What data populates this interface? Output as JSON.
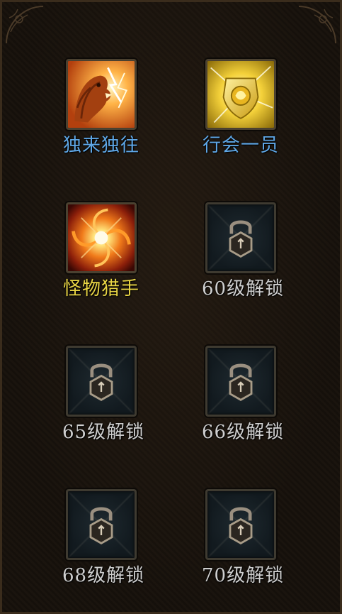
{
  "slots": [
    {
      "label": "独来独往",
      "icon": "lion-roar-icon",
      "state": "unlocked",
      "color": "#5fa7e6"
    },
    {
      "label": "行会一员",
      "icon": "golden-shield-icon",
      "state": "unlocked",
      "color": "#5fa7e6"
    },
    {
      "label": "怪物猎手",
      "icon": "fire-vortex-icon",
      "state": "active",
      "color": "#e9d545"
    },
    {
      "label": "60级解锁",
      "icon": "padlock-icon",
      "state": "locked",
      "color": "#cfcfcf"
    },
    {
      "label": "65级解锁",
      "icon": "padlock-icon",
      "state": "locked",
      "color": "#cfcfcf"
    },
    {
      "label": "66级解锁",
      "icon": "padlock-icon",
      "state": "locked",
      "color": "#cfcfcf"
    },
    {
      "label": "68级解锁",
      "icon": "padlock-icon",
      "state": "locked",
      "color": "#cfcfcf"
    },
    {
      "label": "70级解锁",
      "icon": "padlock-icon",
      "state": "locked",
      "color": "#cfcfcf"
    }
  ]
}
